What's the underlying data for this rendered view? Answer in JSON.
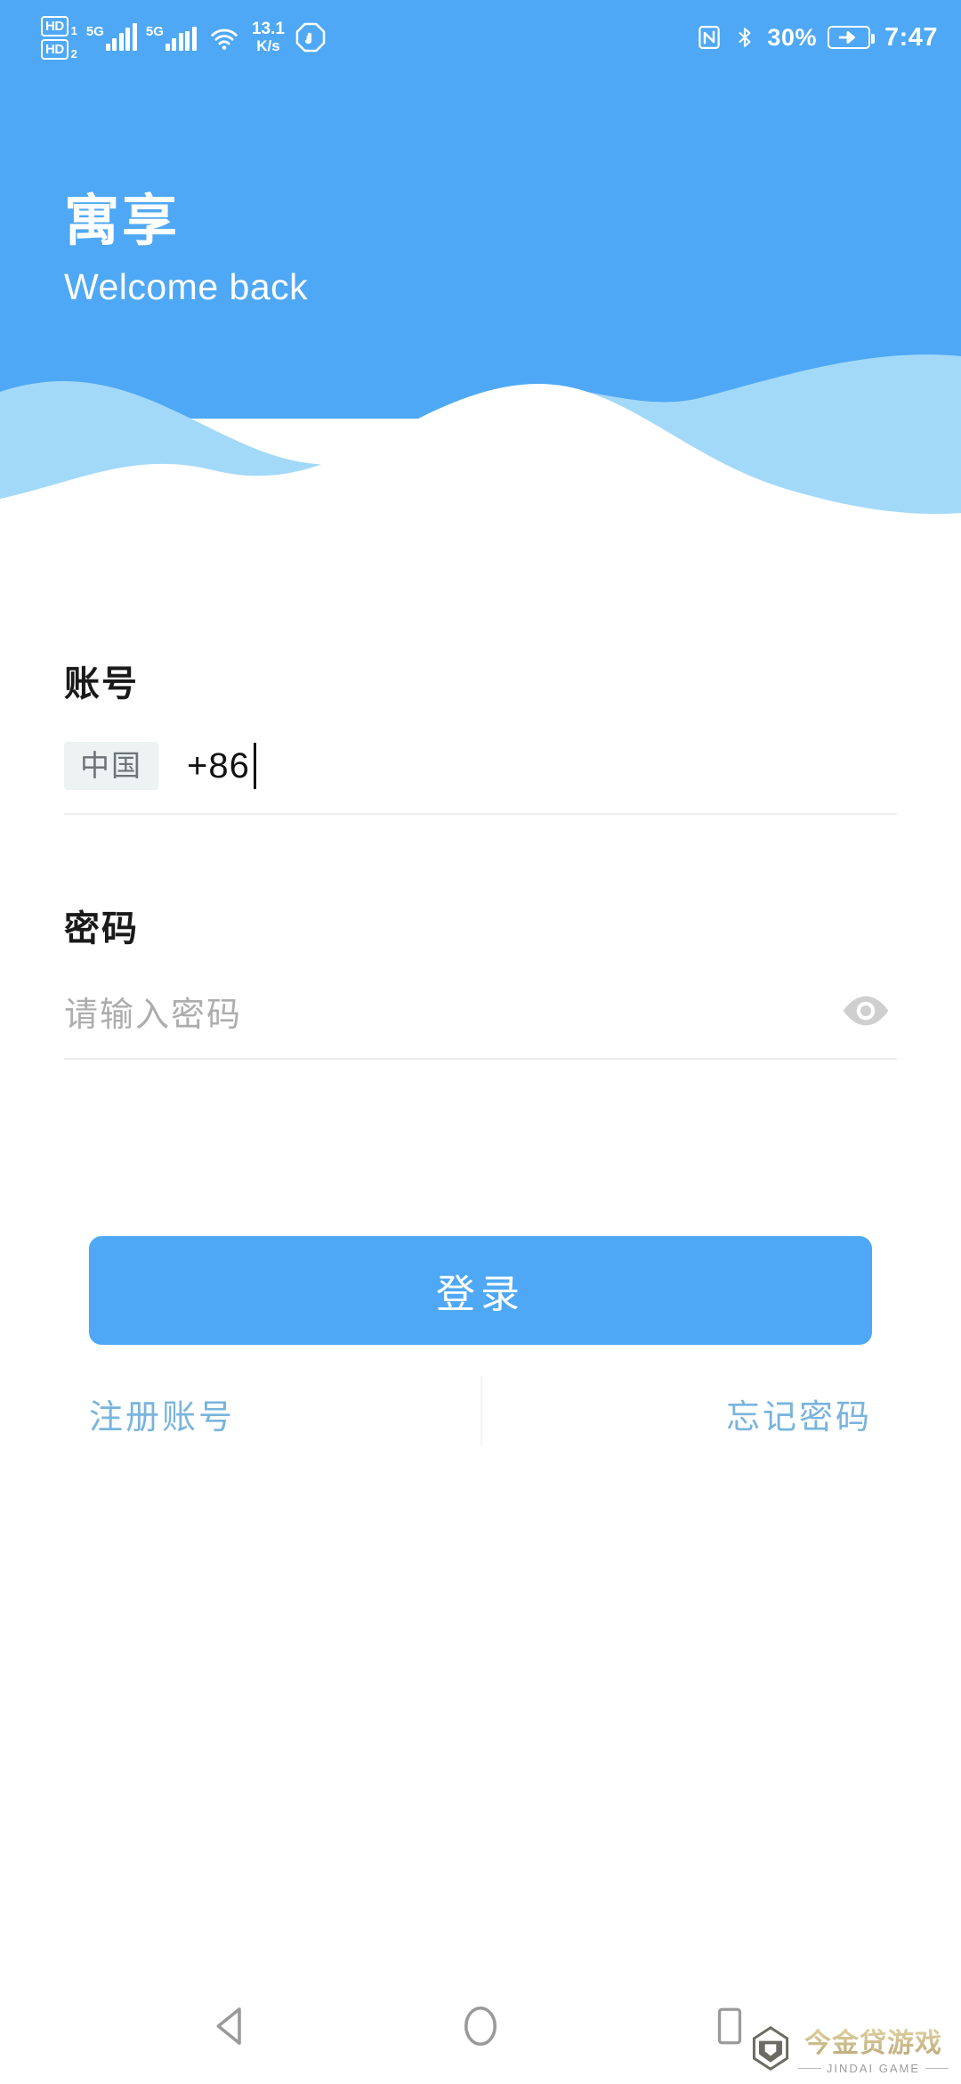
{
  "status_bar": {
    "hd_rows": [
      {
        "badge": "HD",
        "sim": "1"
      },
      {
        "badge": "HD",
        "sim": "2"
      }
    ],
    "signals": [
      {
        "network": "5G",
        "strength": 5
      },
      {
        "network": "5G",
        "strength": 4
      }
    ],
    "wifi_icon": "wifi-icon",
    "net_speed_value": "13.1",
    "net_speed_unit": "K/s",
    "do_not_disturb_icon": "do-not-disturb-icon",
    "nfc_icon": "nfc-icon",
    "bluetooth_icon": "bluetooth-icon",
    "battery_percent": "30%",
    "battery_icon": "battery-charging-icon",
    "time": "7:47"
  },
  "hero": {
    "app_title": "寓享",
    "subtitle": "Welcome back",
    "bg_color": "#4FA8F5",
    "wave_color": "#A3D9F8"
  },
  "form": {
    "account": {
      "label": "账号",
      "country_chip": "中国",
      "value": "+86",
      "caret_visible": true
    },
    "password": {
      "label": "密码",
      "placeholder": "请输入密码",
      "value": "",
      "toggle_icon": "eye-icon"
    }
  },
  "login_button": {
    "label": "登录",
    "color": "#4FA8F5"
  },
  "links": {
    "register": "注册账号",
    "forgot": "忘记密码",
    "color": "#79b4dd"
  },
  "nav_bar": {
    "back_icon": "back-triangle-icon",
    "home_icon": "home-circle-icon",
    "recents_icon": "recents-square-icon"
  },
  "watermark": {
    "logo_icon": "jindai-logo-icon",
    "cn_text": "今金贷游戏",
    "en_text": "JINDAI GAME"
  }
}
